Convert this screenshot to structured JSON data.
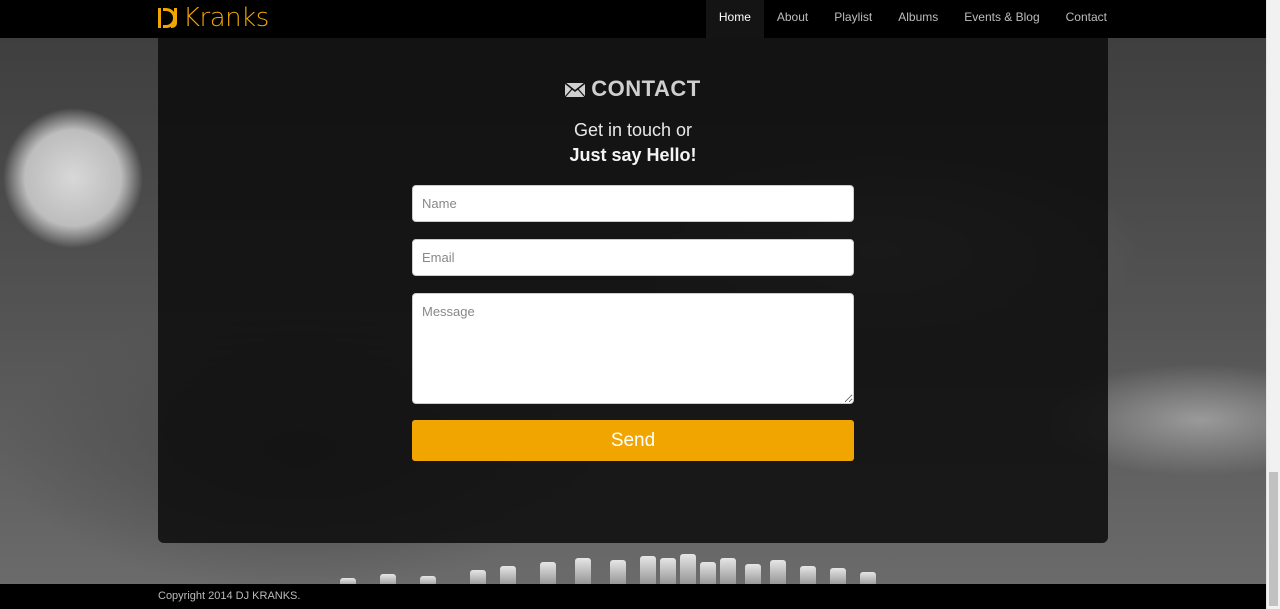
{
  "brand": {
    "name": "Kranks",
    "logo_icon": "dj-logo-icon",
    "color": "#f0a500"
  },
  "nav": {
    "items": [
      {
        "label": "Home",
        "active": true
      },
      {
        "label": "About",
        "active": false
      },
      {
        "label": "Playlist",
        "active": false
      },
      {
        "label": "Albums",
        "active": false
      },
      {
        "label": "Events & Blog",
        "active": false
      },
      {
        "label": "Contact",
        "active": false
      }
    ]
  },
  "contact": {
    "icon": "envelope-icon",
    "title": "CONTACT",
    "subtitle_line1": "Get in touch or",
    "subtitle_line2": "Just say Hello!",
    "fields": {
      "name_placeholder": "Name",
      "email_placeholder": "Email",
      "message_placeholder": "Message"
    },
    "send_label": "Send",
    "accent": "#f0a500"
  },
  "footer": {
    "text": "Copyright 2014 DJ KRANKS."
  }
}
